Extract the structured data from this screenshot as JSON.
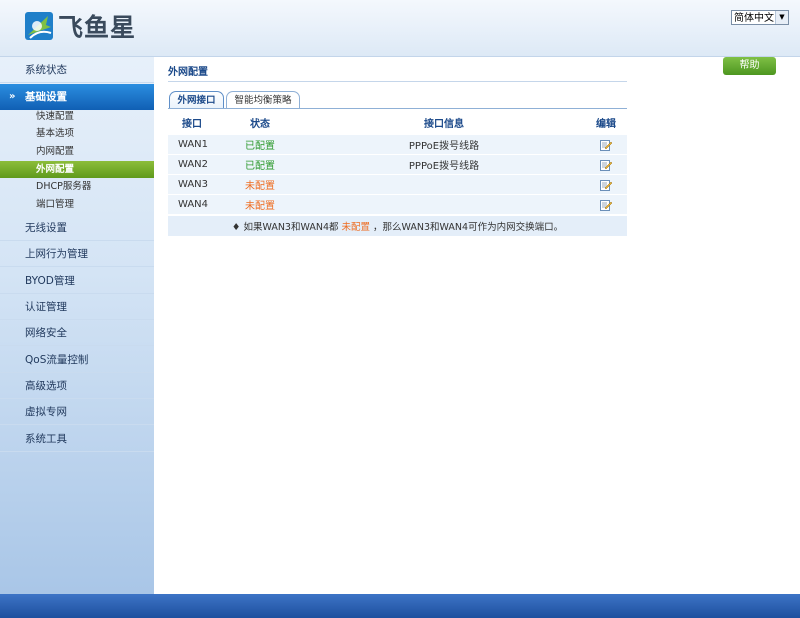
{
  "header": {
    "logo_text": "飞鱼星",
    "language": "简体中文"
  },
  "sidebar": {
    "items": [
      {
        "label": "系统状态"
      },
      {
        "label": "基础设置"
      },
      {
        "label": "无线设置"
      },
      {
        "label": "上网行为管理"
      },
      {
        "label": "BYOD管理"
      },
      {
        "label": "认证管理"
      },
      {
        "label": "网络安全"
      },
      {
        "label": "QoS流量控制"
      },
      {
        "label": "高级选项"
      },
      {
        "label": "虚拟专网"
      },
      {
        "label": "系统工具"
      }
    ],
    "subitems": [
      {
        "label": "快速配置"
      },
      {
        "label": "基本选项"
      },
      {
        "label": "内网配置"
      },
      {
        "label": "外网配置"
      },
      {
        "label": "DHCP服务器"
      },
      {
        "label": "端口管理"
      }
    ]
  },
  "main": {
    "title": "外网配置",
    "help_label": "帮助",
    "tabs": [
      {
        "label": "外网接口"
      },
      {
        "label": "智能均衡策略"
      }
    ],
    "table": {
      "headers": {
        "interface": "接口",
        "status": "状态",
        "info": "接口信息",
        "edit": "编辑"
      },
      "rows": [
        {
          "interface": "WAN1",
          "status": "已配置",
          "info": "PPPoE拨号线路"
        },
        {
          "interface": "WAN2",
          "status": "已配置",
          "info": "PPPoE拨号线路"
        },
        {
          "interface": "WAN3",
          "status": "未配置",
          "info": ""
        },
        {
          "interface": "WAN4",
          "status": "未配置",
          "info": ""
        }
      ]
    },
    "note": {
      "prefix": "♦ 如果WAN3和WAN4都",
      "highlight": "未配置",
      "suffix": "，那么WAN3和WAN4可作为内网交换端口。"
    }
  },
  "colors": {
    "configured": "#2e9a2e",
    "unconfigured": "#ee6b1f",
    "accent": "#105fb4"
  }
}
